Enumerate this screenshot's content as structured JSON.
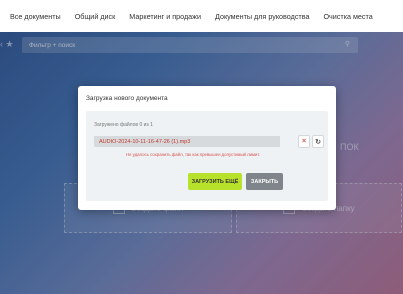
{
  "topnav": {
    "items": [
      "Все документы",
      "Общий диск",
      "Маркетинг и продажи",
      "Документы для руководства",
      "Очистка места"
    ]
  },
  "toolbar": {
    "filter_placeholder": "Фильтр + поиск",
    "nav_arrows": "‹ ★"
  },
  "background": {
    "create_file": "Создать файл",
    "create_folder": "Создать папку",
    "side_text": "ПОК"
  },
  "dialog": {
    "title": "Загрузка нового документа",
    "upload_count": "Загружено файлов 0 из 1",
    "file_name": "AUDIO-2024-10-11-16-47-26 (1).mp3",
    "error": "Не удалось сохранить файл, так как превышен допустимый лимит.",
    "upload_more_label": "ЗАГРУЗИТЬ ЕЩЁ",
    "close_label": "ЗАКРЫТЬ",
    "delete_icon": "×",
    "retry_icon": "↻"
  },
  "colors": {
    "accent_green": "#b8e12b",
    "error_red": "#d9534f",
    "close_gray": "#7f858a"
  }
}
